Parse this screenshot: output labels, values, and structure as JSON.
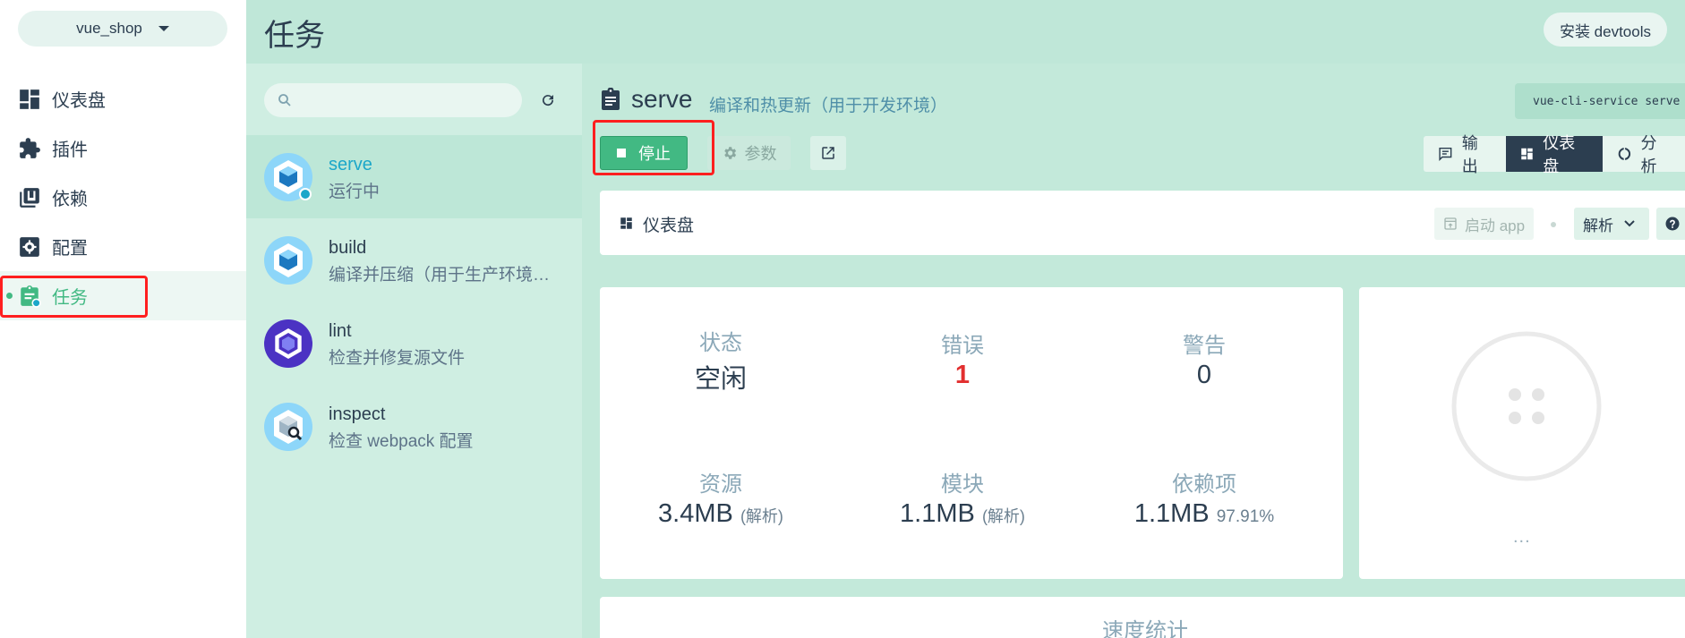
{
  "project": {
    "name": "vue_shop"
  },
  "nav": {
    "items": [
      {
        "label": "仪表盘"
      },
      {
        "label": "插件"
      },
      {
        "label": "依赖"
      },
      {
        "label": "配置"
      },
      {
        "label": "任务"
      }
    ],
    "active_index": 4
  },
  "header": {
    "title": "任务",
    "devtools_label": "安装 devtools"
  },
  "search": {
    "placeholder": ""
  },
  "tasks": [
    {
      "name": "serve",
      "description": "运行中"
    },
    {
      "name": "build",
      "description": "编译并压缩（用于生产环境…"
    },
    {
      "name": "lint",
      "description": "检查并修复源文件"
    },
    {
      "name": "inspect",
      "description": "检查 webpack 配置"
    }
  ],
  "task_detail": {
    "name": "serve",
    "description": "编译和热更新（用于开发环境）",
    "command": "vue-cli-service serve",
    "stop_label": "停止",
    "params_label": "参数"
  },
  "view_tabs": [
    {
      "label": "输出"
    },
    {
      "label": "仪表盘"
    },
    {
      "label": "分析"
    }
  ],
  "dashboard": {
    "title": "仪表盘",
    "launch_app_label": "启动 app",
    "parse_select_value": "解析"
  },
  "stats": {
    "status": {
      "label": "状态",
      "value": "空闲"
    },
    "errors": {
      "label": "错误",
      "value": "1"
    },
    "warnings": {
      "label": "警告",
      "value": "0"
    },
    "assets": {
      "label": "资源",
      "value": "3.4MB",
      "note": "(解析)"
    },
    "modules": {
      "label": "模块",
      "value": "1.1MB",
      "note": "(解析)"
    },
    "dependencies": {
      "label": "依赖项",
      "value": "1.1MB",
      "note": "97.91%"
    }
  },
  "status_card": {
    "more": "..."
  },
  "speed": {
    "title": "速度统计"
  },
  "colors": {
    "accent": "#42b983",
    "error": "#e22f2f",
    "dark": "#2c3e50",
    "running_link": "#1ca7c9"
  }
}
